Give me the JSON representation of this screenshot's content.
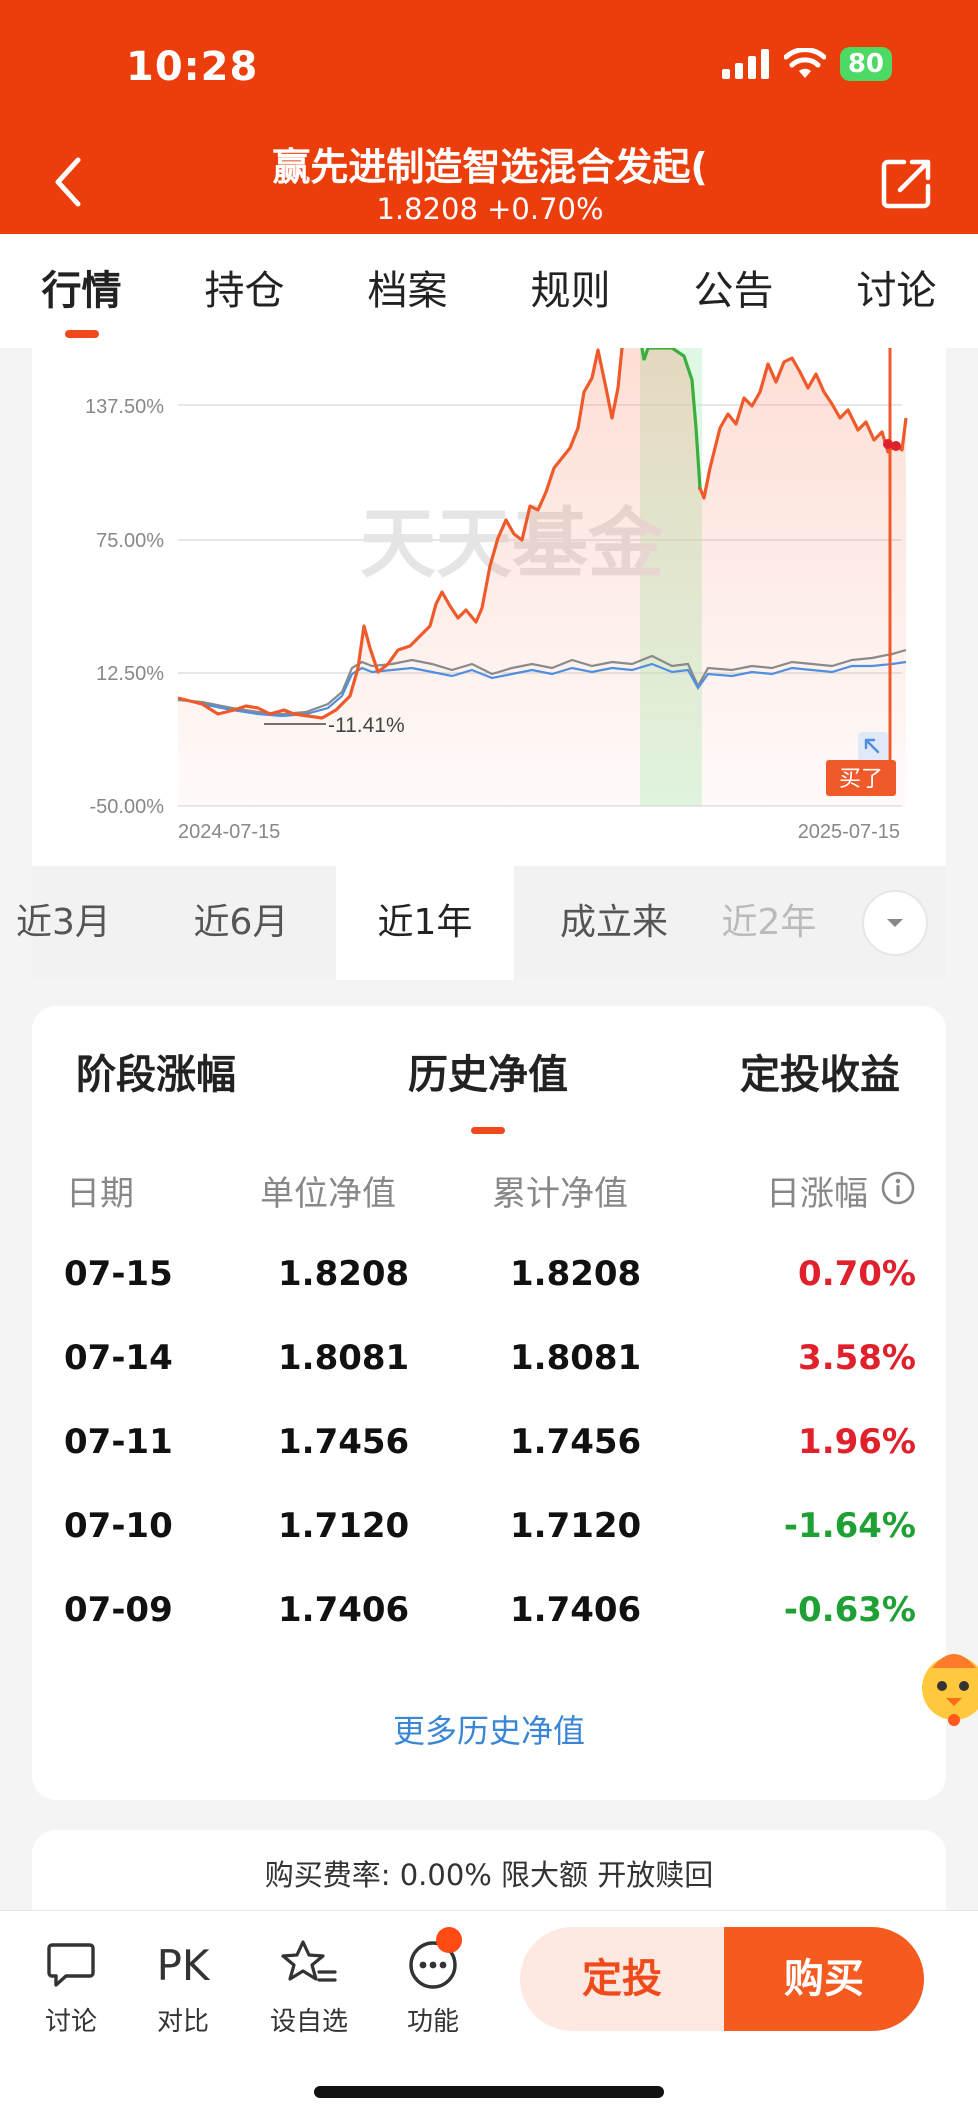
{
  "status": {
    "time": "10:28",
    "battery": "80"
  },
  "header": {
    "title": "赢先进制造智选混合发起(",
    "subtitle": "1.8208 +0.70%"
  },
  "tabs": [
    "行情",
    "持仓",
    "档案",
    "规则",
    "公告",
    "讨论"
  ],
  "chart": {
    "y_labels": [
      "137.50%",
      "75.00%",
      "12.50%",
      "-50.00%"
    ],
    "x_start": "2024-07-15",
    "x_end": "2025-07-15",
    "watermark": "天天基金",
    "min_label": "-11.41%",
    "buy_badge": "买了"
  },
  "ranges": [
    "近3月",
    "近6月",
    "近1年",
    "成立来",
    "近2年"
  ],
  "nav_card": {
    "tabs": [
      "阶段涨幅",
      "历史净值",
      "定投收益"
    ],
    "headers": [
      "日期",
      "单位净值",
      "累计净值",
      "日涨幅"
    ],
    "rows": [
      {
        "date": "07-15",
        "unit": "1.8208",
        "cum": "1.8208",
        "change": "0.70%",
        "dir": "up"
      },
      {
        "date": "07-14",
        "unit": "1.8081",
        "cum": "1.8081",
        "change": "3.58%",
        "dir": "up"
      },
      {
        "date": "07-11",
        "unit": "1.7456",
        "cum": "1.7456",
        "change": "1.96%",
        "dir": "up"
      },
      {
        "date": "07-10",
        "unit": "1.7120",
        "cum": "1.7120",
        "change": "-1.64%",
        "dir": "down"
      },
      {
        "date": "07-09",
        "unit": "1.7406",
        "cum": "1.7406",
        "change": "-0.63%",
        "dir": "down"
      }
    ],
    "more": "更多历史净值"
  },
  "fee": "购买费率: 0.00% 限大额 开放赎回",
  "bottom": {
    "items": [
      {
        "label": "讨论",
        "icon": "chat-bubble-icon"
      },
      {
        "label": "对比",
        "icon": "pk-icon",
        "glyph": "PK"
      },
      {
        "label": "设自选",
        "icon": "star-list-icon"
      },
      {
        "label": "功能",
        "icon": "more-dots-icon"
      }
    ],
    "dingtou": "定投",
    "buy": "购买"
  },
  "colors": {
    "brand": "#ec3e0c",
    "up": "#e0202a",
    "down": "#1ea035",
    "link": "#3a86d6"
  }
}
